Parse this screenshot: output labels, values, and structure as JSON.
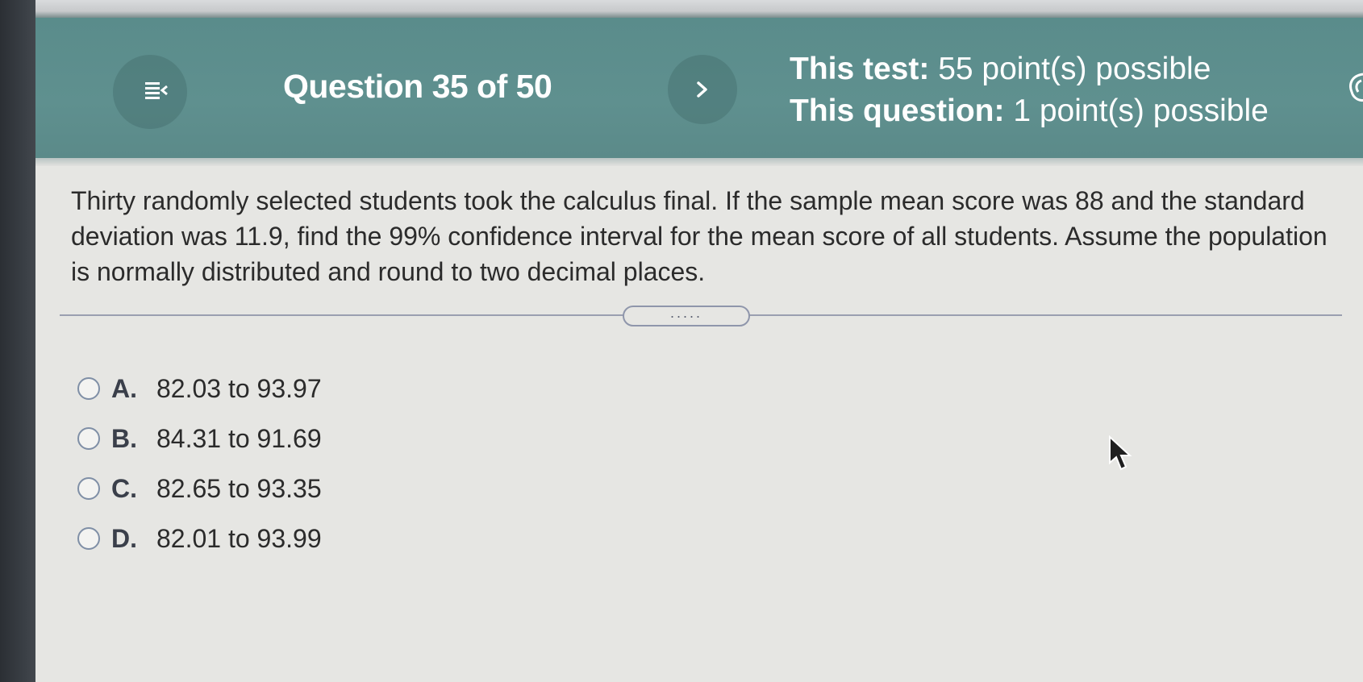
{
  "header": {
    "question_title": "Question 35 of 50",
    "test_points_label": "This test:",
    "test_points_value": "55 point(s) possible",
    "question_points_label": "This question:",
    "question_points_value": "1 point(s) possible"
  },
  "question": {
    "text": "Thirty randomly selected students took the calculus final. If the sample mean score was 88 and the standard deviation was 11.9, find the 99% confidence interval for the mean score of all students. Assume the population is normally distributed and round to two decimal places."
  },
  "divider": {
    "handle_text": "....."
  },
  "options": [
    {
      "letter": "A.",
      "text": "82.03 to 93.97"
    },
    {
      "letter": "B.",
      "text": "84.31 to 91.69"
    },
    {
      "letter": "C.",
      "text": "82.65 to 93.35"
    },
    {
      "letter": "D.",
      "text": "82.01 to 93.99"
    }
  ],
  "icons": {
    "menu": "menu-collapse-icon",
    "next": "chevron-right-icon",
    "settings": "gear-icon"
  },
  "colors": {
    "header_bg": "#5f908f",
    "radio_border": "#7f8fa6",
    "text": "#2b2b2b"
  }
}
